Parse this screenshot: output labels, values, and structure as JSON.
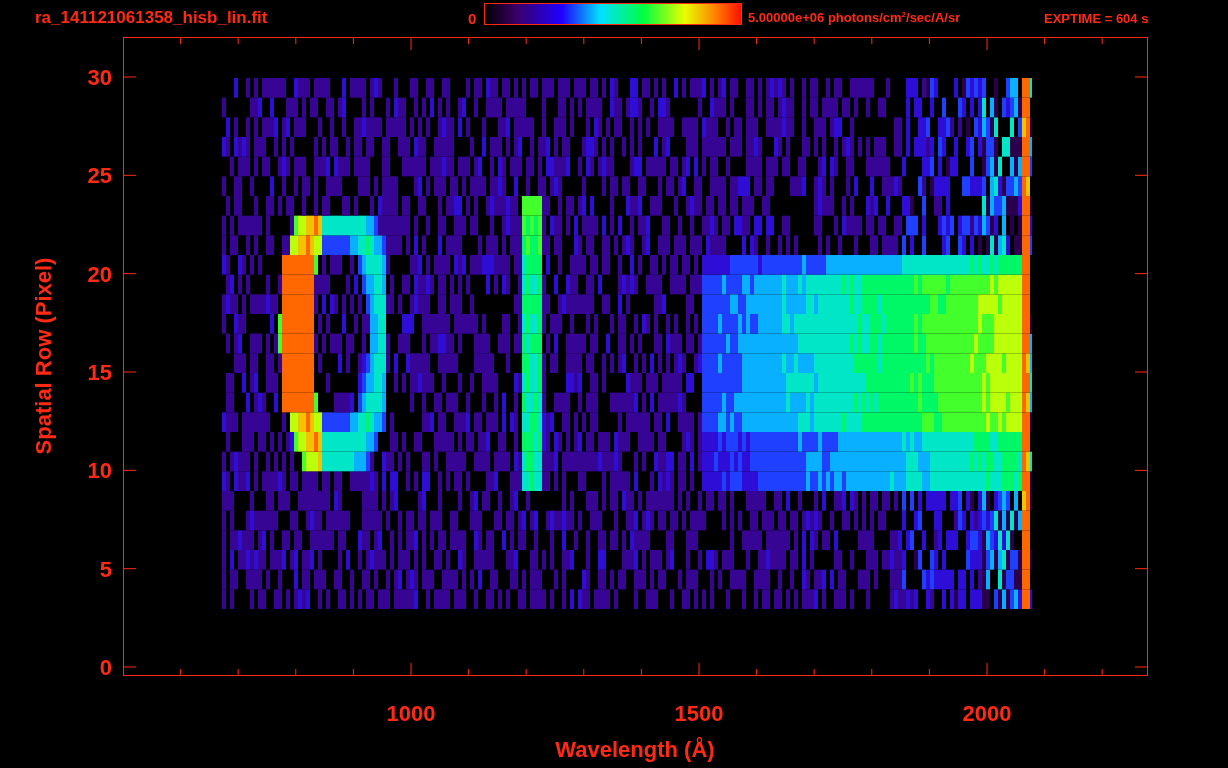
{
  "file_name": "ra_141121061358_hisb_lin.fit",
  "colorbar": {
    "min_label": "0",
    "max_label": "5.00000e+06 photons/cm$^{2}$/sec/A/sr"
  },
  "exposure": "EXPTIME = 604 s",
  "plot": {
    "xlabel": "Wavelength (Å)",
    "ylabel": "Spatial Row (Pixel)",
    "xticks": [
      "1000",
      "1500",
      "2000"
    ],
    "yticks": [
      "30",
      "25",
      "20",
      "15",
      "10",
      "5",
      "0"
    ]
  }
}
